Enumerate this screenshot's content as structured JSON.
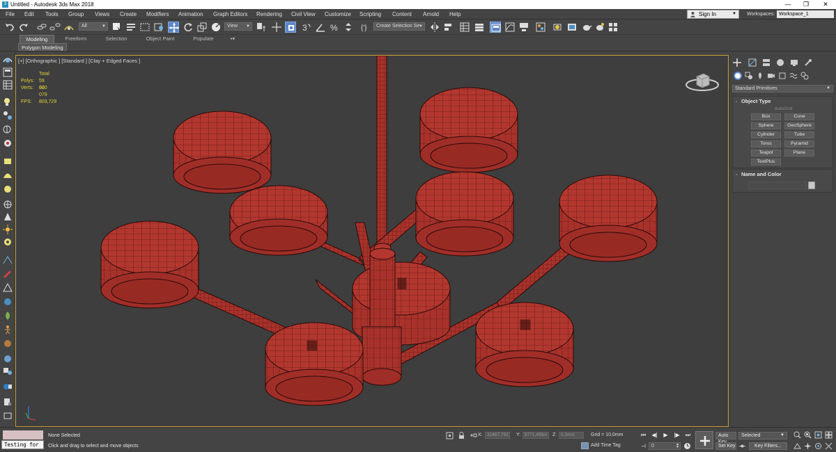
{
  "window": {
    "title": "Untitled - Autodesk 3ds Max 2018",
    "minimize": "—",
    "restore": "❐",
    "close": "✕"
  },
  "menu": [
    "File",
    "Edit",
    "Tools",
    "Group",
    "Views",
    "Create",
    "Modifiers",
    "Animation",
    "Graph Editors",
    "Rendering",
    "Civil View",
    "Customize",
    "Scripting",
    "Content",
    "Arnold",
    "Help"
  ],
  "account": {
    "sign_in": "Sign In",
    "workspaces_label": "Workspaces:",
    "workspace": "Workspace_1"
  },
  "toolbar": {
    "filter_value": "All",
    "refcoord_value": "View",
    "selection_set_placeholder": "Create Selection Se"
  },
  "ribbon": {
    "tabs": [
      "Modeling",
      "Freeform",
      "Selection",
      "Object Paint",
      "Populate"
    ],
    "active_tab": "Modeling",
    "sub_label": "Polygon Modeling"
  },
  "viewport": {
    "label": "[+] [Orthographic ] [Standard ] [Clay + Edged Faces ]",
    "stats": {
      "total_label": "Total",
      "polys_label": "Polys:",
      "polys": "59 020",
      "verts_label": "Verts:",
      "verts": "30 079",
      "fps_label": "FPS:",
      "fps": "803,729"
    }
  },
  "command_panel": {
    "category": "Standard Primitives",
    "object_type_title": "Object Type",
    "autogrid": "AutoGrid",
    "primitives": [
      "Box",
      "Cone",
      "Sphere",
      "GeoSphere",
      "Cylinder",
      "Tube",
      "Torus",
      "Pyramid",
      "Teapot",
      "Plane",
      "TextPlus"
    ],
    "name_color_title": "Name and Color"
  },
  "status": {
    "maxscript_text": "Testing for :",
    "selection_status": "None Selected",
    "prompt": "Click and drag to select and move objects",
    "x_label": "X:",
    "x_value": "32467,793",
    "y_label": "Y:",
    "y_value": "9771,498m",
    "z_label": "Z:",
    "z_value": "0,0mm",
    "grid": "Grid = 10,0mm",
    "add_time_tag": "Add Time Tag",
    "frame": "0",
    "auto_key": "Auto Key",
    "set_key": "Set Key",
    "selected": "Selected",
    "key_filters": "Key Filters..."
  },
  "colors": {
    "model_red": "#a8322b",
    "viewport_bg": "#3e3e3e",
    "active_border": "#c9a53a",
    "stats_yellow": "#e3d23a",
    "active_blue": "#5b87c5"
  }
}
